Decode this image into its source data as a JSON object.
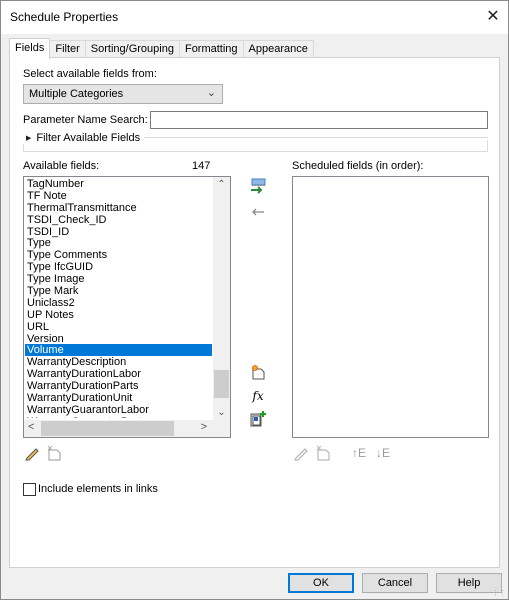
{
  "window": {
    "title": "Schedule Properties",
    "close_icon": "close-icon"
  },
  "tabs": [
    {
      "label": "Fields",
      "active": true
    },
    {
      "label": "Filter",
      "active": false
    },
    {
      "label": "Sorting/Grouping",
      "active": false
    },
    {
      "label": "Formatting",
      "active": false
    },
    {
      "label": "Appearance",
      "active": false
    }
  ],
  "fields_tab": {
    "select_label": "Select available fields from:",
    "select_value": "Multiple Categories",
    "search_label": "Parameter Name Search:",
    "search_value": "",
    "filter_toggle_label": "Filter Available Fields",
    "available_label": "Available fields:",
    "available_count": "147",
    "scheduled_label": "Scheduled fields (in order):",
    "available_fields": [
      "TagNumber",
      "TF Note",
      "ThermalTransmittance",
      "TSDI_Check_ID",
      "TSDI_ID",
      "Type",
      "Type Comments",
      "Type IfcGUID",
      "Type Image",
      "Type Mark",
      "Uniclass2",
      "UP Notes",
      "URL",
      "Version",
      "Volume",
      "WarrantyDescription",
      "WarrantyDurationLabor",
      "WarrantyDurationParts",
      "WarrantyDurationUnit",
      "WarrantyGuarantorLabor",
      "WarrantyGuarantorParts"
    ],
    "selected_field": "Volume",
    "scheduled_fields": [],
    "include_links_label": "Include elements in links",
    "include_links_checked": false
  },
  "buttons": {
    "ok": "OK",
    "cancel": "Cancel",
    "help": "Help"
  },
  "colors": {
    "selection": "#0078d7",
    "add_arrow": "#2e8b3a"
  }
}
